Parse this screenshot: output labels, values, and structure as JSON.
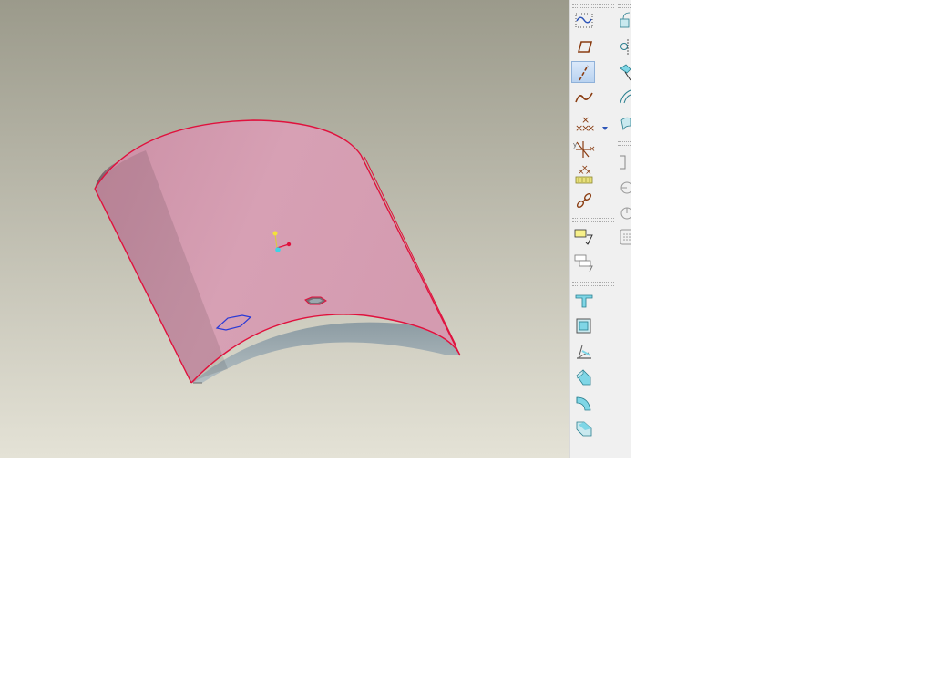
{
  "app": {
    "title": ""
  },
  "viewport": {
    "background_top": "#9b9a8b",
    "background_bottom": "#e4e2d6",
    "part_color": "#d49bb0",
    "edge_color": "#e0113d",
    "thickness_color": "#9aa8ae",
    "sketch_color": "#2a3ad6"
  },
  "toolbar": {
    "left_column": [
      {
        "id": "sketched-datum-curve",
        "icon": "dotted-curve-icon"
      },
      {
        "id": "datum-plane",
        "icon": "plane-icon"
      },
      {
        "id": "datum-axis",
        "icon": "axis-icon",
        "active": true
      },
      {
        "id": "datum-curve",
        "icon": "curve-icon"
      },
      {
        "id": "datum-point",
        "icon": "point-icon",
        "has_dropdown": true
      },
      {
        "id": "coordinate-system",
        "icon": "csys-icon"
      },
      {
        "id": "analysis-feature",
        "icon": "analysis-icon"
      },
      {
        "id": "chain",
        "icon": "chain-icon"
      },
      {
        "id": "annotation-feature",
        "icon": "annotation-icon"
      },
      {
        "id": "annotation-element",
        "icon": "annotation-element-icon"
      },
      {
        "id": "wall",
        "icon": "wall-icon"
      },
      {
        "id": "shell",
        "icon": "shell-icon"
      },
      {
        "id": "draft",
        "icon": "draft-icon"
      },
      {
        "id": "rib",
        "icon": "rib-icon"
      },
      {
        "id": "round",
        "icon": "round-icon"
      },
      {
        "id": "chamfer",
        "icon": "chamfer-icon"
      }
    ],
    "right_column": [
      {
        "id": "extrude",
        "icon": "extrude-icon"
      },
      {
        "id": "revolve",
        "icon": "revolve-icon"
      },
      {
        "id": "sweep",
        "icon": "sweep-icon"
      },
      {
        "id": "blend",
        "icon": "blend-icon"
      },
      {
        "id": "boundary",
        "icon": "boundary-icon"
      },
      {
        "id": "flange",
        "icon": "flange-icon"
      },
      {
        "id": "pattern-dim",
        "icon": "pattern-dimension-icon"
      },
      {
        "id": "pattern-axis",
        "icon": "pattern-axis-icon"
      },
      {
        "id": "pattern-grid",
        "icon": "grid-icon"
      }
    ]
  }
}
